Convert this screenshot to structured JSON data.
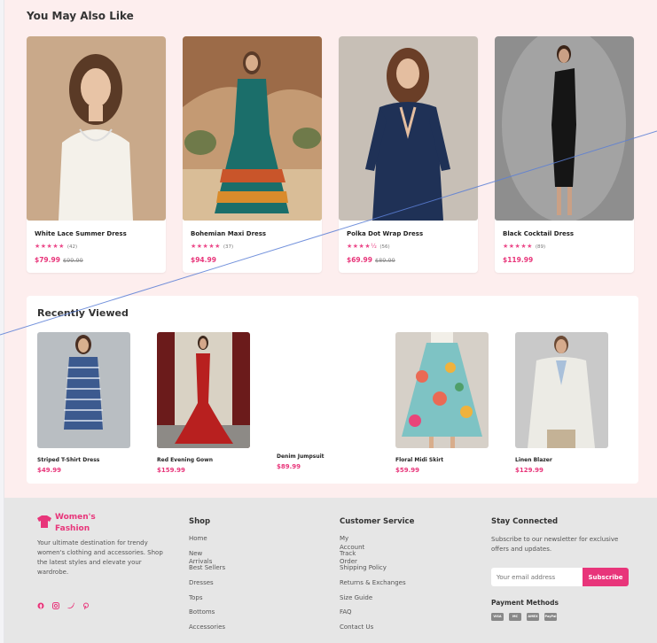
{
  "recommendations": {
    "title": "You May Also Like",
    "products": [
      {
        "name": "White Lace Summer Dress",
        "stars": "★★★★★",
        "reviews": "(42)",
        "price": "$79.99",
        "old_price": "$99.99"
      },
      {
        "name": "Bohemian Maxi Dress",
        "stars": "★★★★★",
        "reviews": "(37)",
        "price": "$94.99",
        "old_price": ""
      },
      {
        "name": "Polka Dot Wrap Dress",
        "stars": "★★★★½",
        "reviews": "(56)",
        "price": "$69.99",
        "old_price": "$89.99"
      },
      {
        "name": "Black Cocktail Dress",
        "stars": "★★★★★",
        "reviews": "(89)",
        "price": "$119.99",
        "old_price": ""
      }
    ]
  },
  "recently_viewed": {
    "title": "Recently Viewed",
    "items": [
      {
        "name": "Striped T-Shirt Dress",
        "price": "$49.99"
      },
      {
        "name": "Red Evening Gown",
        "price": "$159.99"
      },
      {
        "name": "Denim Jumpsuit",
        "price": "$89.99"
      },
      {
        "name": "Floral Midi Skirt",
        "price": "$59.99"
      },
      {
        "name": "Linen Blazer",
        "price": "$129.99"
      }
    ]
  },
  "footer": {
    "brand": "Women's Fashion",
    "tagline": "Your ultimate destination for trendy women's clothing and accessories. Shop the latest styles and elevate your wardrobe.",
    "socials": [
      "facebook-icon",
      "instagram-icon",
      "twitter-icon",
      "pinterest-icon"
    ],
    "shop": {
      "title": "Shop",
      "links": [
        "Home",
        "New Arrivals",
        "Best Sellers",
        "Dresses",
        "Tops",
        "Bottoms",
        "Accessories"
      ]
    },
    "customer_service": {
      "title": "Customer Service",
      "links": [
        "My Account",
        "Track Order",
        "Shipping Policy",
        "Returns & Exchanges",
        "Size Guide",
        "FAQ",
        "Contact Us"
      ]
    },
    "stay_connected": {
      "title": "Stay Connected",
      "text": "Subscribe to our newsletter for exclusive offers and updates.",
      "email_placeholder": "Your email address",
      "subscribe_label": "Subscribe",
      "payment_title": "Payment Methods",
      "payment_methods": [
        "VISA",
        "MC",
        "AMEX",
        "PayPal"
      ]
    }
  },
  "colors": {
    "accent": "#e8357a",
    "star": "#ec4a8a",
    "footer_bg": "#e6e6e6",
    "page_bg": "#fdeeee"
  }
}
